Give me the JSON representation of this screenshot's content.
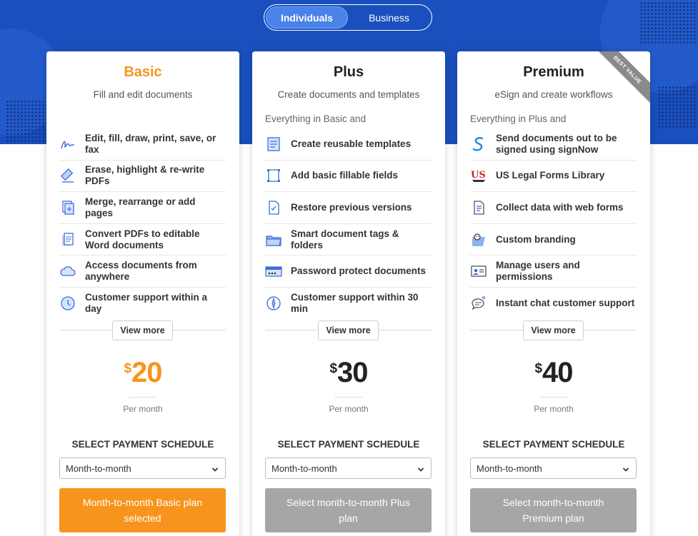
{
  "toggle": {
    "individuals": "Individuals",
    "business": "Business"
  },
  "colors": {
    "brand_blue": "#1a4fbd",
    "accent_orange": "#f7941d",
    "disabled_grey": "#a6a6a6"
  },
  "plans": [
    {
      "name": "Basic",
      "subtitle": "Fill and edit documents",
      "everything": "",
      "features": [
        {
          "icon": "signature-icon",
          "label": "Edit, fill, draw, print, save, or fax"
        },
        {
          "icon": "eraser-icon",
          "label": "Erase, highlight & re-write PDFs"
        },
        {
          "icon": "add-pages-icon",
          "label": "Merge, rearrange or add pages"
        },
        {
          "icon": "convert-doc-icon",
          "label": "Convert PDFs to editable Word documents"
        },
        {
          "icon": "cloud-icon",
          "label": "Access documents from anywhere"
        },
        {
          "icon": "clock-icon",
          "label": "Customer support within a day"
        }
      ],
      "view_more": "View more",
      "currency": "$",
      "price": "20",
      "per": "Per month",
      "schedule_label": "SELECT PAYMENT SCHEDULE",
      "schedule_value": "Month-to-month",
      "cta": "Month-to-month Basic plan selected"
    },
    {
      "name": "Plus",
      "subtitle": "Create documents and templates",
      "everything": "Everything in Basic and",
      "features": [
        {
          "icon": "template-icon",
          "label": "Create reusable templates"
        },
        {
          "icon": "fillable-fields-icon",
          "label": "Add basic fillable fields"
        },
        {
          "icon": "restore-version-icon",
          "label": "Restore previous versions"
        },
        {
          "icon": "folder-icon",
          "label": "Smart document tags & folders"
        },
        {
          "icon": "password-icon",
          "label": "Password protect documents"
        },
        {
          "icon": "compass-icon",
          "label": "Customer support within 30 min"
        }
      ],
      "view_more": "View more",
      "currency": "$",
      "price": "30",
      "per": "Per month",
      "schedule_label": "SELECT PAYMENT SCHEDULE",
      "schedule_value": "Month-to-month",
      "cta": "Select month-to-month Plus plan"
    },
    {
      "name": "Premium",
      "subtitle": "eSign and create workflows",
      "everything": "Everything in Plus and",
      "ribbon": "BEST VALUE",
      "features": [
        {
          "icon": "signnow-icon",
          "label": "Send documents out to be signed using signNow"
        },
        {
          "icon": "us-legal-forms-icon",
          "label": "US Legal Forms Library"
        },
        {
          "icon": "web-form-icon",
          "label": "Collect data with web forms"
        },
        {
          "icon": "branding-icon",
          "label": "Custom branding"
        },
        {
          "icon": "user-card-icon",
          "label": "Manage users and permissions"
        },
        {
          "icon": "chat-icon",
          "label": "Instant chat customer support"
        }
      ],
      "view_more": "View more",
      "currency": "$",
      "price": "40",
      "per": "Per month",
      "schedule_label": "SELECT PAYMENT SCHEDULE",
      "schedule_value": "Month-to-month",
      "cta": "Select month-to-month Premium plan"
    }
  ]
}
